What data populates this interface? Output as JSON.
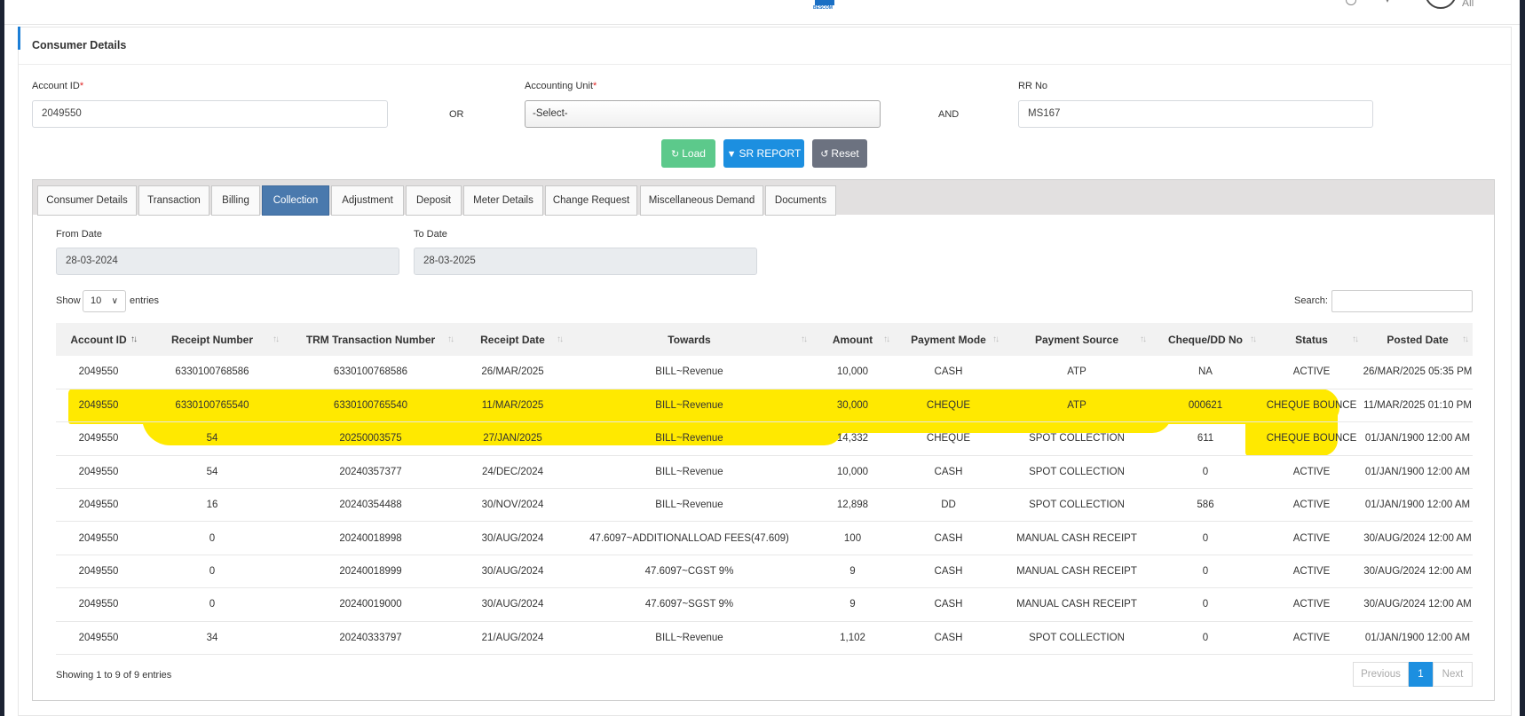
{
  "header": {
    "logo_text": "BESCOM",
    "all_label": "All"
  },
  "panel": {
    "title": "Consumer Details"
  },
  "form": {
    "account_id_label": "Account ID",
    "account_id_value": "2049550",
    "or_label": "OR",
    "accounting_unit_label": "Accounting Unit",
    "accounting_unit_value": "-Select-",
    "and_label": "AND",
    "rr_no_label": "RR No",
    "rr_no_value": "MS167",
    "required_mark": "*"
  },
  "buttons": {
    "load": "Load",
    "sr_report": "SR REPORT",
    "reset": "Reset"
  },
  "tabs": [
    {
      "label": "Consumer Details"
    },
    {
      "label": "Transaction"
    },
    {
      "label": "Billing"
    },
    {
      "label": "Collection",
      "active": true
    },
    {
      "label": "Adjustment"
    },
    {
      "label": "Deposit"
    },
    {
      "label": "Meter Details"
    },
    {
      "label": "Change Request"
    },
    {
      "label": "Miscellaneous Demand"
    },
    {
      "label": "Documents"
    }
  ],
  "filters": {
    "from_date_label": "From Date",
    "from_date_value": "28-03-2024",
    "to_date_label": "To Date",
    "to_date_value": "28-03-2025"
  },
  "table_controls": {
    "show_label": "Show",
    "page_length": "10",
    "entries_label": "entries",
    "search_label": "Search:"
  },
  "table": {
    "columns": [
      "Account ID",
      "Receipt Number",
      "TRM Transaction Number",
      "Receipt Date",
      "Towards",
      "Amount",
      "Payment Mode",
      "Payment Source",
      "Cheque/DD No",
      "Status",
      "Posted Date"
    ],
    "rows": [
      [
        "2049550",
        "6330100768586",
        "6330100768586",
        "26/MAR/2025",
        "BILL~Revenue",
        "10,000",
        "CASH",
        "ATP",
        "NA",
        "ACTIVE",
        "26/MAR/2025 05:35 PM"
      ],
      [
        "2049550",
        "6330100765540",
        "6330100765540",
        "11/MAR/2025",
        "BILL~Revenue",
        "30,000",
        "CHEQUE",
        "ATP",
        "000621",
        "CHEQUE BOUNCE",
        "11/MAR/2025 01:10 PM"
      ],
      [
        "2049550",
        "54",
        "20250003575",
        "27/JAN/2025",
        "BILL~Revenue",
        "14,332",
        "CHEQUE",
        "SPOT COLLECTION",
        "611",
        "CHEQUE BOUNCE",
        "01/JAN/1900 12:00 AM"
      ],
      [
        "2049550",
        "54",
        "20240357377",
        "24/DEC/2024",
        "BILL~Revenue",
        "10,000",
        "CASH",
        "SPOT COLLECTION",
        "0",
        "ACTIVE",
        "01/JAN/1900 12:00 AM"
      ],
      [
        "2049550",
        "16",
        "20240354488",
        "30/NOV/2024",
        "BILL~Revenue",
        "12,898",
        "DD",
        "SPOT COLLECTION",
        "586",
        "ACTIVE",
        "01/JAN/1900 12:00 AM"
      ],
      [
        "2049550",
        "0",
        "20240018998",
        "30/AUG/2024",
        "47.6097~ADDITIONALLOAD FEES(47.609)",
        "100",
        "CASH",
        "MANUAL CASH RECEIPT",
        "0",
        "ACTIVE",
        "30/AUG/2024 12:00 AM"
      ],
      [
        "2049550",
        "0",
        "20240018999",
        "30/AUG/2024",
        "47.6097~CGST 9%",
        "9",
        "CASH",
        "MANUAL CASH RECEIPT",
        "0",
        "ACTIVE",
        "30/AUG/2024 12:00 AM"
      ],
      [
        "2049550",
        "0",
        "20240019000",
        "30/AUG/2024",
        "47.6097~SGST 9%",
        "9",
        "CASH",
        "MANUAL CASH RECEIPT",
        "0",
        "ACTIVE",
        "30/AUG/2024 12:00 AM"
      ],
      [
        "2049550",
        "34",
        "20240333797",
        "21/AUG/2024",
        "BILL~Revenue",
        "1,102",
        "CASH",
        "SPOT COLLECTION",
        "0",
        "ACTIVE",
        "01/JAN/1900 12:00 AM"
      ]
    ]
  },
  "footer": {
    "info": "Showing 1 to 9 of 9 entries",
    "previous": "Previous",
    "current_page": "1",
    "next": "Next"
  },
  "colors": {
    "highlight": "#ffe900",
    "active_tab": "#4a79ad",
    "load_button": "#5cc98b",
    "sr_button": "#1c8fe0",
    "reset_button": "#6c7280"
  }
}
